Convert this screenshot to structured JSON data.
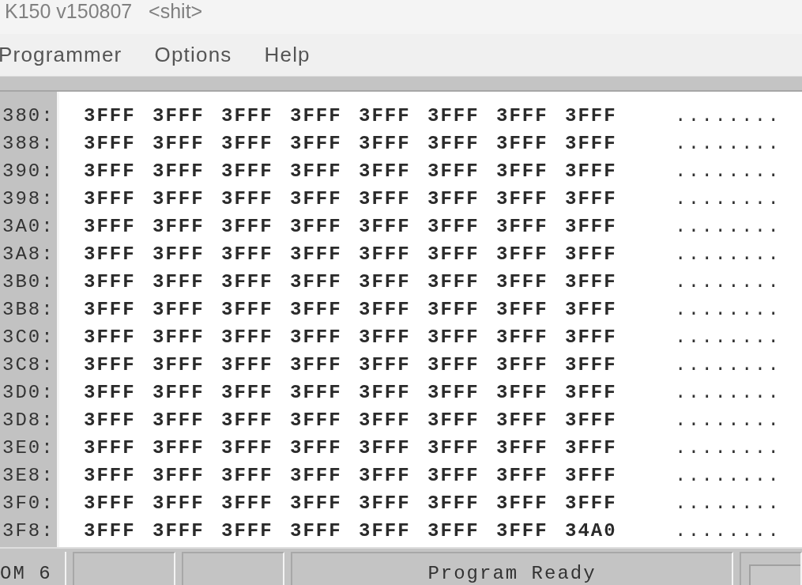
{
  "window": {
    "title": "K150 v150807   <shit>"
  },
  "menu": [
    "Programmer",
    "Options",
    "Help"
  ],
  "hex_view": {
    "rows": [
      {
        "address": "380:",
        "words": [
          "3FFF",
          "3FFF",
          "3FFF",
          "3FFF",
          "3FFF",
          "3FFF",
          "3FFF",
          "3FFF"
        ],
        "ascii": "........"
      },
      {
        "address": "388:",
        "words": [
          "3FFF",
          "3FFF",
          "3FFF",
          "3FFF",
          "3FFF",
          "3FFF",
          "3FFF",
          "3FFF"
        ],
        "ascii": "........"
      },
      {
        "address": "390:",
        "words": [
          "3FFF",
          "3FFF",
          "3FFF",
          "3FFF",
          "3FFF",
          "3FFF",
          "3FFF",
          "3FFF"
        ],
        "ascii": "........"
      },
      {
        "address": "398:",
        "words": [
          "3FFF",
          "3FFF",
          "3FFF",
          "3FFF",
          "3FFF",
          "3FFF",
          "3FFF",
          "3FFF"
        ],
        "ascii": "........"
      },
      {
        "address": "3A0:",
        "words": [
          "3FFF",
          "3FFF",
          "3FFF",
          "3FFF",
          "3FFF",
          "3FFF",
          "3FFF",
          "3FFF"
        ],
        "ascii": "........"
      },
      {
        "address": "3A8:",
        "words": [
          "3FFF",
          "3FFF",
          "3FFF",
          "3FFF",
          "3FFF",
          "3FFF",
          "3FFF",
          "3FFF"
        ],
        "ascii": "........"
      },
      {
        "address": "3B0:",
        "words": [
          "3FFF",
          "3FFF",
          "3FFF",
          "3FFF",
          "3FFF",
          "3FFF",
          "3FFF",
          "3FFF"
        ],
        "ascii": "........"
      },
      {
        "address": "3B8:",
        "words": [
          "3FFF",
          "3FFF",
          "3FFF",
          "3FFF",
          "3FFF",
          "3FFF",
          "3FFF",
          "3FFF"
        ],
        "ascii": "........"
      },
      {
        "address": "3C0:",
        "words": [
          "3FFF",
          "3FFF",
          "3FFF",
          "3FFF",
          "3FFF",
          "3FFF",
          "3FFF",
          "3FFF"
        ],
        "ascii": "........"
      },
      {
        "address": "3C8:",
        "words": [
          "3FFF",
          "3FFF",
          "3FFF",
          "3FFF",
          "3FFF",
          "3FFF",
          "3FFF",
          "3FFF"
        ],
        "ascii": "........"
      },
      {
        "address": "3D0:",
        "words": [
          "3FFF",
          "3FFF",
          "3FFF",
          "3FFF",
          "3FFF",
          "3FFF",
          "3FFF",
          "3FFF"
        ],
        "ascii": "........"
      },
      {
        "address": "3D8:",
        "words": [
          "3FFF",
          "3FFF",
          "3FFF",
          "3FFF",
          "3FFF",
          "3FFF",
          "3FFF",
          "3FFF"
        ],
        "ascii": "........"
      },
      {
        "address": "3E0:",
        "words": [
          "3FFF",
          "3FFF",
          "3FFF",
          "3FFF",
          "3FFF",
          "3FFF",
          "3FFF",
          "3FFF"
        ],
        "ascii": "........"
      },
      {
        "address": "3E8:",
        "words": [
          "3FFF",
          "3FFF",
          "3FFF",
          "3FFF",
          "3FFF",
          "3FFF",
          "3FFF",
          "3FFF"
        ],
        "ascii": "........"
      },
      {
        "address": "3F0:",
        "words": [
          "3FFF",
          "3FFF",
          "3FFF",
          "3FFF",
          "3FFF",
          "3FFF",
          "3FFF",
          "3FFF"
        ],
        "ascii": "........"
      },
      {
        "address": "3F8:",
        "words": [
          "3FFF",
          "3FFF",
          "3FFF",
          "3FFF",
          "3FFF",
          "3FFF",
          "3FFF",
          "34A0"
        ],
        "ascii": "........"
      }
    ]
  },
  "status_bar": {
    "port": "OM 6",
    "message": "Program Ready"
  }
}
